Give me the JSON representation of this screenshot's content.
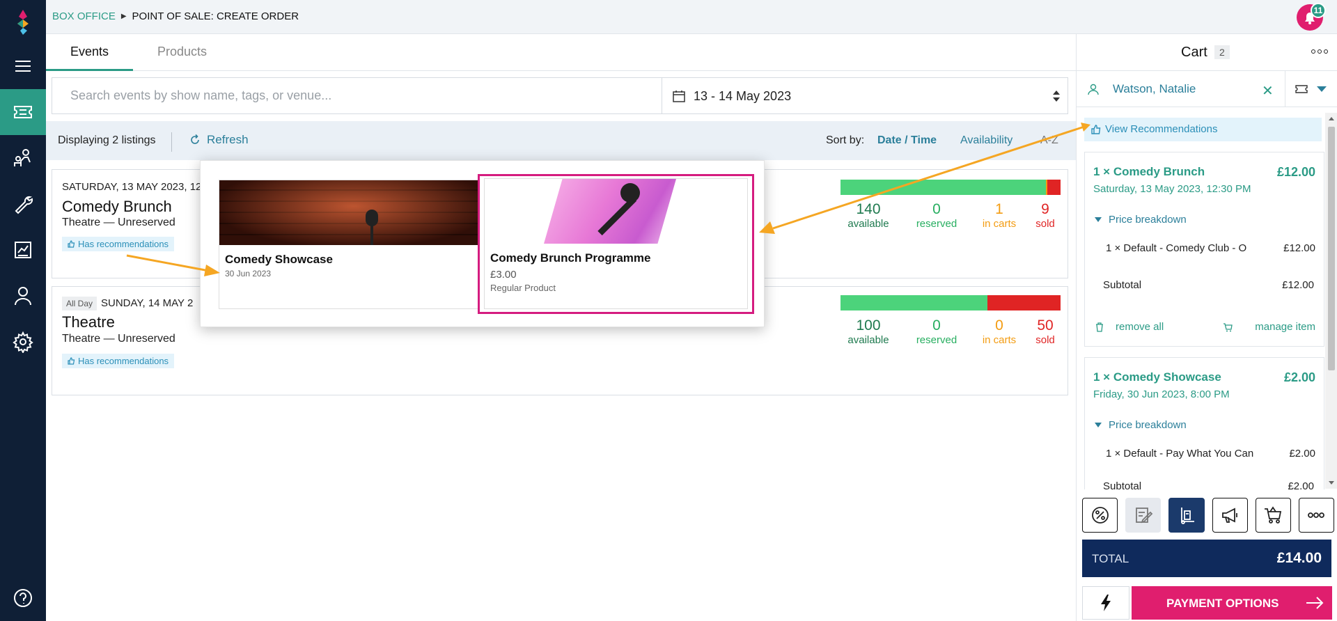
{
  "header": {
    "crumb_root": "BOX OFFICE",
    "crumb_page": "POINT OF SALE: CREATE ORDER",
    "notifications": "11"
  },
  "nav": {
    "items": [
      "hamburger-menu-icon",
      "ticket-icon",
      "people-icon",
      "wrench-icon",
      "report-icon",
      "user-icon",
      "settings-icon"
    ],
    "help": "help-icon"
  },
  "tabs": {
    "events": "Events",
    "products": "Products"
  },
  "search": {
    "placeholder": "Search events by show name, tags, or venue...",
    "value": ""
  },
  "date_range": "13 - 14 May 2023",
  "filters": {
    "count": "Displaying 2 listings",
    "refresh": "Refresh",
    "sort_by": "Sort by:",
    "sort_date": "Date / Time",
    "sort_availability": "Availability",
    "sort_az": "A-Z"
  },
  "events": [
    {
      "date": "SATURDAY, 13 MAY 2023, 12",
      "all_day": "",
      "title": "Comedy Brunch",
      "subtitle": "Theatre — Unreserved",
      "rec": "Has recommendations",
      "available": "140",
      "available_label": "available",
      "reserved": "0",
      "reserved_label": "reserved",
      "in_carts": "1",
      "in_carts_label": "in carts",
      "sold": "9",
      "sold_label": "sold",
      "bar_fractions": {
        "available": 0.933,
        "in_carts": 0.007,
        "sold": 0.06
      }
    },
    {
      "date": "SUNDAY, 14 MAY 2",
      "all_day": "All Day",
      "title": "Theatre",
      "subtitle": "Theatre — Unreserved",
      "rec": "Has recommendations",
      "available": "100",
      "available_label": "available",
      "reserved": "0",
      "reserved_label": "reserved",
      "in_carts": "0",
      "in_carts_label": "in carts",
      "sold": "50",
      "sold_label": "sold",
      "bar_fractions": {
        "available": 0.667,
        "in_carts": 0,
        "sold": 0.333
      }
    }
  ],
  "recommendations": [
    {
      "title": "Comedy Showcase",
      "date": "30 Jun 2023"
    },
    {
      "title": "Comedy Brunch Programme",
      "price": "£3.00",
      "kind": "Regular Product"
    }
  ],
  "cart": {
    "title": "Cart",
    "count": "2",
    "customer": "Watson, Natalie",
    "view_recommendations": "View Recommendations",
    "items": [
      {
        "name": "1 × Comedy Brunch",
        "price": "£12.00",
        "date": "Saturday, 13 May 2023, 12:30 PM",
        "breakdown": "Price breakdown",
        "line": "1 × Default - Comedy Club - O",
        "line_price": "£12.00",
        "subtotal_label": "Subtotal",
        "subtotal": "£12.00",
        "remove": "remove all",
        "manage": "manage item"
      },
      {
        "name": "1 × Comedy Showcase",
        "price": "£2.00",
        "date": "Friday, 30 Jun 2023, 8:00 PM",
        "breakdown": "Price breakdown",
        "line": "1 × Default - Pay What You Can",
        "line_price": "£2.00",
        "subtotal_label": "Subtotal",
        "subtotal": "£2.00"
      }
    ],
    "tools": [
      "discount-icon",
      "notes-icon",
      "delivery-icon",
      "promo-megaphone-icon",
      "cart-icon",
      "more-icon"
    ],
    "total_label": "TOTAL",
    "total": "£14.00",
    "pay_label": "PAYMENT OPTIONS"
  },
  "colors": {
    "nav_bg": "#0f1f36",
    "accent": "#2b9b86",
    "available": "#4cd37b",
    "sold": "#e02424",
    "in_carts": "#f39c12",
    "pay": "#e01e6e",
    "total_bg": "#0f2a5c",
    "highlight": "#d51c7f",
    "annotation_arrow": "#f5a623"
  }
}
